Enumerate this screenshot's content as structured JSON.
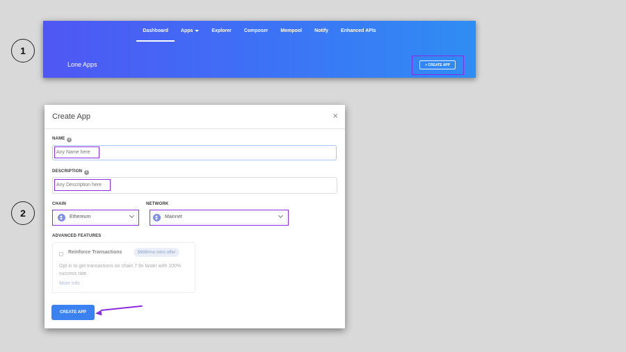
{
  "steps": [
    "1",
    "2"
  ],
  "nav": {
    "items": [
      {
        "label": "Dashboard",
        "active": true
      },
      {
        "label": "Apps",
        "active": false,
        "dropdown": true
      },
      {
        "label": "Explorer",
        "active": false
      },
      {
        "label": "Composer",
        "active": false
      },
      {
        "label": "Mempool",
        "active": false
      },
      {
        "label": "Notify",
        "active": false
      },
      {
        "label": "Enhanced APIs",
        "active": false
      }
    ]
  },
  "banner": {
    "title": "Lone Apps",
    "create_label": "+ CREATE APP"
  },
  "modal": {
    "title": "Create App",
    "close_glyph": "×",
    "name_label": "NAME",
    "name_placeholder": "Any Name here",
    "description_label": "DESCRIPTION",
    "description_placeholder": "Any Description here",
    "chain_label": "CHAIN",
    "chain_value": "Ethereum",
    "network_label": "NETWORK",
    "network_value": "Mainnet",
    "advanced_label": "ADVANCED FEATURES",
    "advanced": {
      "title": "Reinforce Transactions",
      "offer": "$999/mo intro offer",
      "description": "Opt in to get transactions on chain 7.9x faster with 100% success rate.",
      "more_info": "More Info"
    },
    "submit_label": "CREATE APP"
  },
  "colors": {
    "banner_start": "#4f57f3",
    "banner_end": "#2f8df3",
    "highlight": "#8a2be2",
    "primary_button": "#3b82f0"
  }
}
